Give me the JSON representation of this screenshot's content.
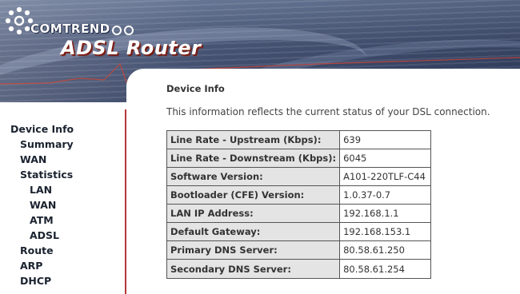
{
  "header": {
    "brand": "COMTREND",
    "product": "ADSL Router"
  },
  "sidebar": {
    "items": [
      {
        "label": "Device Info",
        "level": 0
      },
      {
        "label": "Summary",
        "level": 1
      },
      {
        "label": "WAN",
        "level": 1
      },
      {
        "label": "Statistics",
        "level": 1
      },
      {
        "label": "LAN",
        "level": 2
      },
      {
        "label": "WAN",
        "level": 2
      },
      {
        "label": "ATM",
        "level": 2
      },
      {
        "label": "ADSL",
        "level": 2
      },
      {
        "label": "Route",
        "level": 1
      },
      {
        "label": "ARP",
        "level": 1
      },
      {
        "label": "DHCP",
        "level": 1
      }
    ]
  },
  "main": {
    "title": "Device Info",
    "intro": "This information reflects the current status of your DSL connection.",
    "rows": [
      {
        "label": "Line Rate - Upstream (Kbps):",
        "value": "639"
      },
      {
        "label": "Line Rate - Downstream (Kbps):",
        "value": "6045"
      },
      {
        "label": "Software Version:",
        "value": "A101-220TLF-C44"
      },
      {
        "label": "Bootloader (CFE) Version:",
        "value": "1.0.37-0.7"
      },
      {
        "label": "LAN IP Address:",
        "value": "192.168.1.1"
      },
      {
        "label": "Default Gateway:",
        "value": "192.168.153.1"
      },
      {
        "label": "Primary DNS Server:",
        "value": "80.58.61.250"
      },
      {
        "label": "Secondary DNS Server:",
        "value": "80.58.61.254"
      }
    ]
  },
  "colors": {
    "banner": "#3d4b6d",
    "sidebar_border": "#b5373a",
    "label_cell": "#e4e4e4"
  }
}
